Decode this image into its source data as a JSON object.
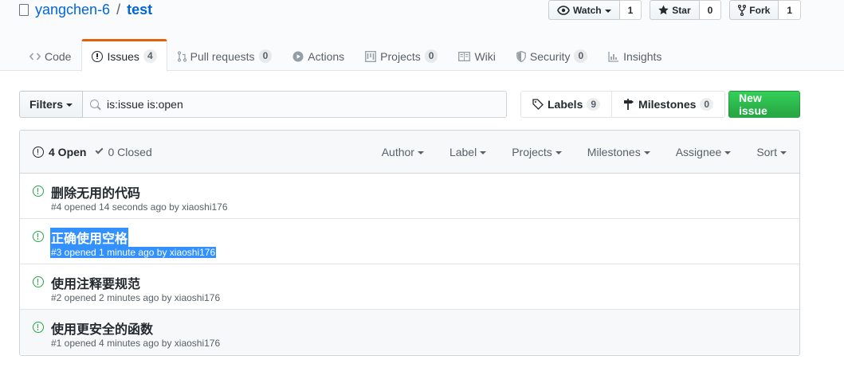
{
  "repo": {
    "owner": "yangchen-6",
    "separator": "/",
    "name": "test"
  },
  "actions": {
    "watch": {
      "label": "Watch",
      "count": "1"
    },
    "star": {
      "label": "Star",
      "count": "0"
    },
    "fork": {
      "label": "Fork",
      "count": "1"
    }
  },
  "nav": {
    "code": "Code",
    "issues": {
      "label": "Issues",
      "count": "4"
    },
    "pulls": {
      "label": "Pull requests",
      "count": "0"
    },
    "actions": "Actions",
    "projects": {
      "label": "Projects",
      "count": "0"
    },
    "wiki": "Wiki",
    "security": {
      "label": "Security",
      "count": "0"
    },
    "insights": "Insights"
  },
  "subnav": {
    "filters": "Filters",
    "search_value": "is:issue is:open",
    "labels": {
      "label": "Labels",
      "count": "9"
    },
    "milestones": {
      "label": "Milestones",
      "count": "0"
    },
    "new_issue": "New issue"
  },
  "list_header": {
    "open": "4 Open",
    "closed": "0 Closed",
    "filters": {
      "author": "Author",
      "label": "Label",
      "projects": "Projects",
      "milestones": "Milestones",
      "assignee": "Assignee",
      "sort": "Sort"
    }
  },
  "issues": [
    {
      "title": "删除无用的代码",
      "meta": "#4 opened 14 seconds ago by xiaoshi176"
    },
    {
      "title": "正确使用空格",
      "meta": "#3 opened 1 minute ago by xiaoshi176"
    },
    {
      "title": "使用注释要规范",
      "meta": "#2 opened 2 minutes ago by xiaoshi176"
    },
    {
      "title": "使用更安全的函数",
      "meta": "#1 opened 4 minutes ago by xiaoshi176"
    }
  ],
  "colors": {
    "accent": "#e36209",
    "link": "#0366d6",
    "open_green": "#28a745",
    "selection": "#3390ff"
  }
}
